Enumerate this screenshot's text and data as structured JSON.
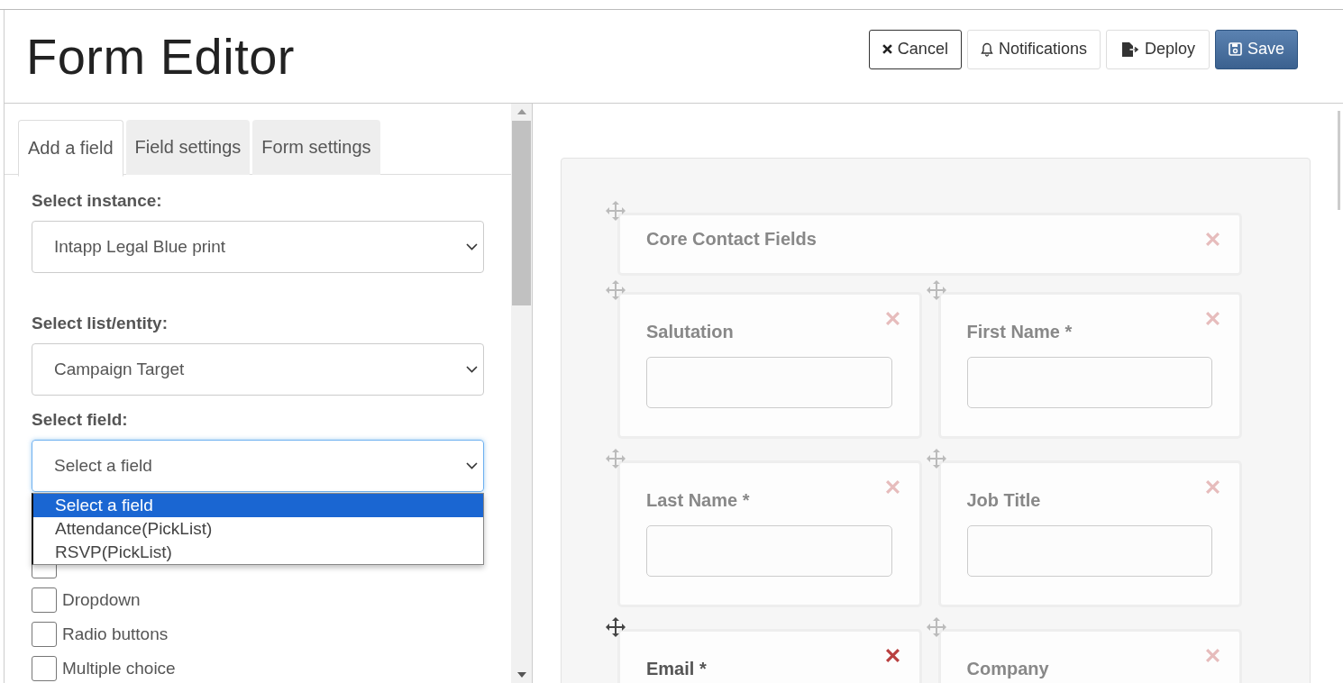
{
  "header": {
    "title": "Form Editor",
    "buttons": [
      {
        "kind": "cancel",
        "label": "Cancel"
      },
      {
        "kind": "notifications",
        "label": "Notifications"
      },
      {
        "kind": "deploy",
        "label": "Deploy"
      },
      {
        "kind": "save",
        "label": "Save"
      }
    ]
  },
  "tabs": [
    {
      "label": "Add a field",
      "selected": true
    },
    {
      "label": "Field settings",
      "selected": false
    },
    {
      "label": "Form settings",
      "selected": false
    }
  ],
  "selects": [
    {
      "label": "Select instance:",
      "value": "Intapp Legal Blue print",
      "focused": false
    },
    {
      "label": "Select list/entity:",
      "value": "Campaign Target",
      "focused": false
    },
    {
      "label": "Select field:",
      "value": "Select a field",
      "focused": true
    }
  ],
  "dropdown_options": [
    {
      "label": "Select a field",
      "selected": true
    },
    {
      "label": "Attendance(PickList)",
      "selected": false
    },
    {
      "label": "RSVP(PickList)",
      "selected": false
    }
  ],
  "options": [
    {
      "checked": false
    },
    {
      "label": "Dropdown",
      "checked": false
    },
    {
      "label": "Radio buttons",
      "checked": false
    },
    {
      "label": "Multiple choice",
      "checked": false
    }
  ],
  "canvas": {
    "items": [
      {
        "kind": "section",
        "label": "Core Contact Fields",
        "active": false
      },
      {
        "kind": "field",
        "label": "Salutation",
        "active": false
      },
      {
        "kind": "field",
        "label": "First Name *",
        "active": false
      },
      {
        "kind": "field",
        "label": "Last Name *",
        "active": false
      },
      {
        "kind": "field",
        "label": "Job Title",
        "active": false
      },
      {
        "kind": "field",
        "label": "Email *",
        "active": true
      },
      {
        "kind": "field",
        "label": "Company",
        "active": false
      }
    ]
  }
}
